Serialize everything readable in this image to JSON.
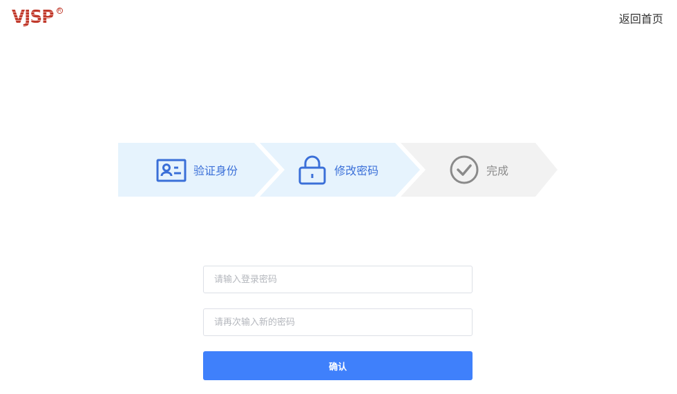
{
  "header": {
    "logo_text": "VJSP",
    "logo_mark": "R",
    "back_home_label": "返回首页"
  },
  "steps": [
    {
      "label": "验证身份",
      "icon": "id-card-icon",
      "state": "active"
    },
    {
      "label": "修改密码",
      "icon": "lock-icon",
      "state": "active"
    },
    {
      "label": "完成",
      "icon": "check-circle-icon",
      "state": "inactive"
    }
  ],
  "colors": {
    "step_active_bg": "#e6f3fd",
    "step_inactive_bg": "#f2f2f2",
    "step_active_fg": "#3a6fd8",
    "step_inactive_fg": "#8a8a8a",
    "logo": "#c0392b",
    "button": "#3f80fb"
  },
  "form": {
    "login_password_placeholder": "请输入登录密码",
    "login_password_value": "",
    "new_password_placeholder": "请再次输入新的密码",
    "new_password_value": "",
    "confirm_label": "确认"
  }
}
